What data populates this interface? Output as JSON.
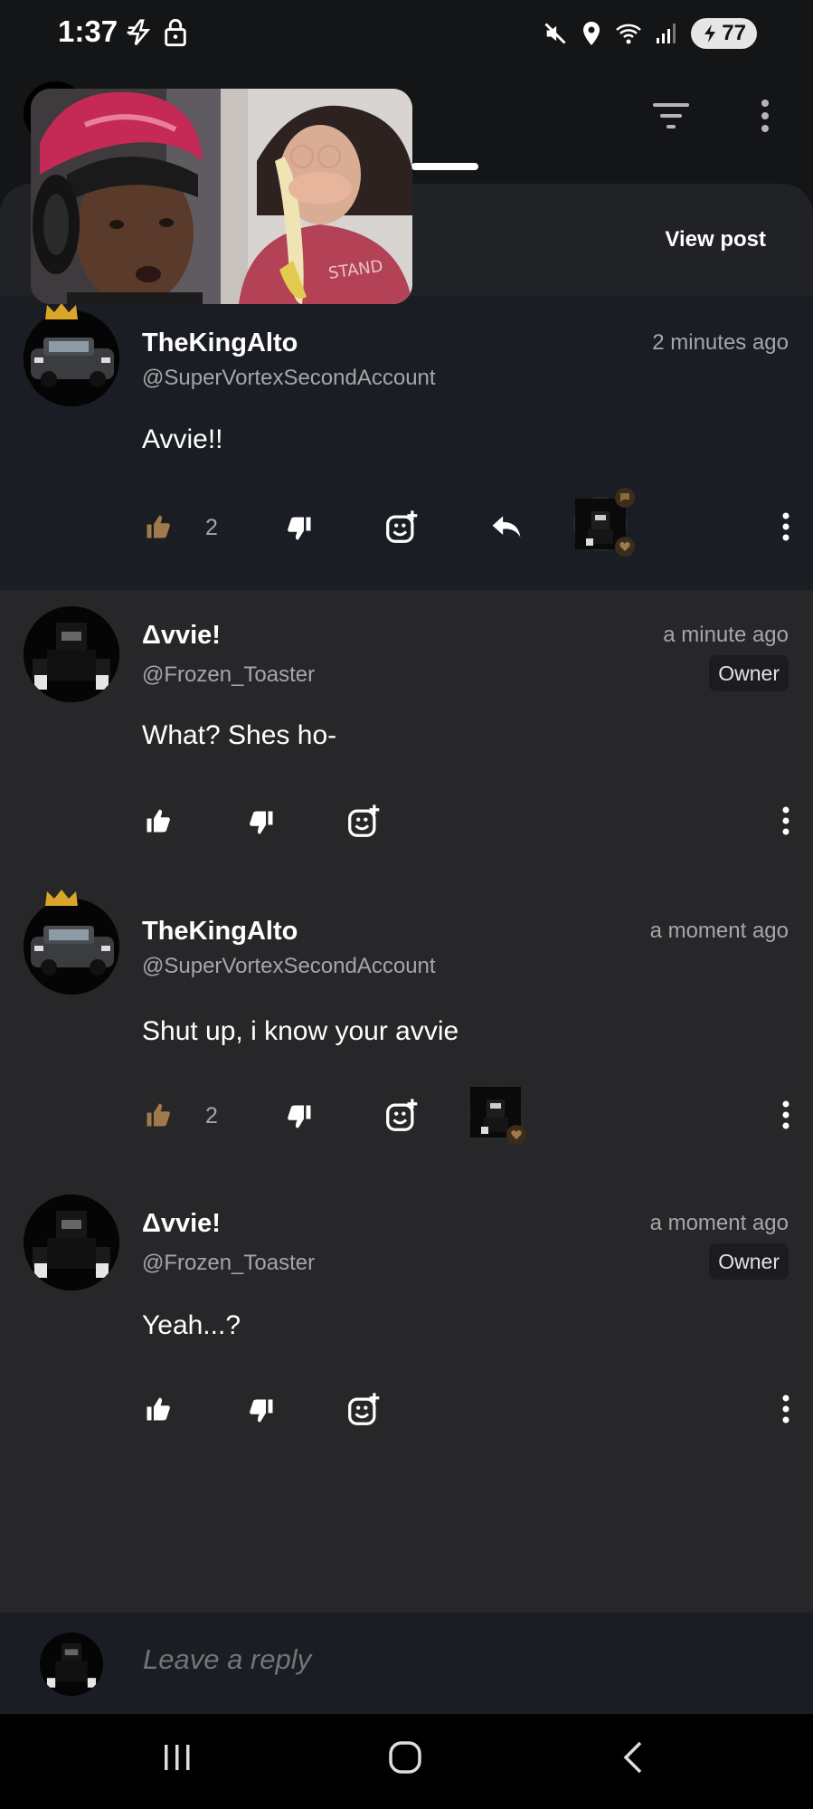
{
  "status_bar": {
    "time": "1:37",
    "battery": "77"
  },
  "app_bar": {
    "filter_icon": "filter-icon",
    "more_icon": "more-vertical-icon"
  },
  "header": {
    "view_post_label": "View post"
  },
  "comments": [
    {
      "name": "TheKingAlto",
      "handle": "@SuperVortexSecondAccount",
      "time": "2 minutes ago",
      "text": "Avvie!!",
      "likes": "2",
      "badge": "",
      "liked": true
    },
    {
      "name": "Δvvie!",
      "handle": "@Frozen_Toaster",
      "time": "a minute ago",
      "text": "What? Shes ho-",
      "likes": "",
      "badge": "Owner",
      "liked": false
    },
    {
      "name": "TheKingAlto",
      "handle": "@SuperVortexSecondAccount",
      "time": "a moment ago",
      "text": "Shut up, i know your avvie",
      "likes": "2",
      "badge": "",
      "liked": true
    },
    {
      "name": "Δvvie!",
      "handle": "@Frozen_Toaster",
      "time": "a moment ago",
      "text": "Yeah...?",
      "likes": "",
      "badge": "Owner",
      "liked": false
    }
  ],
  "reply": {
    "placeholder": "Leave a reply"
  },
  "colors": {
    "liked_accent": "#a17a4b",
    "background": "#272729",
    "highlight_bg": "#1b1d24"
  }
}
